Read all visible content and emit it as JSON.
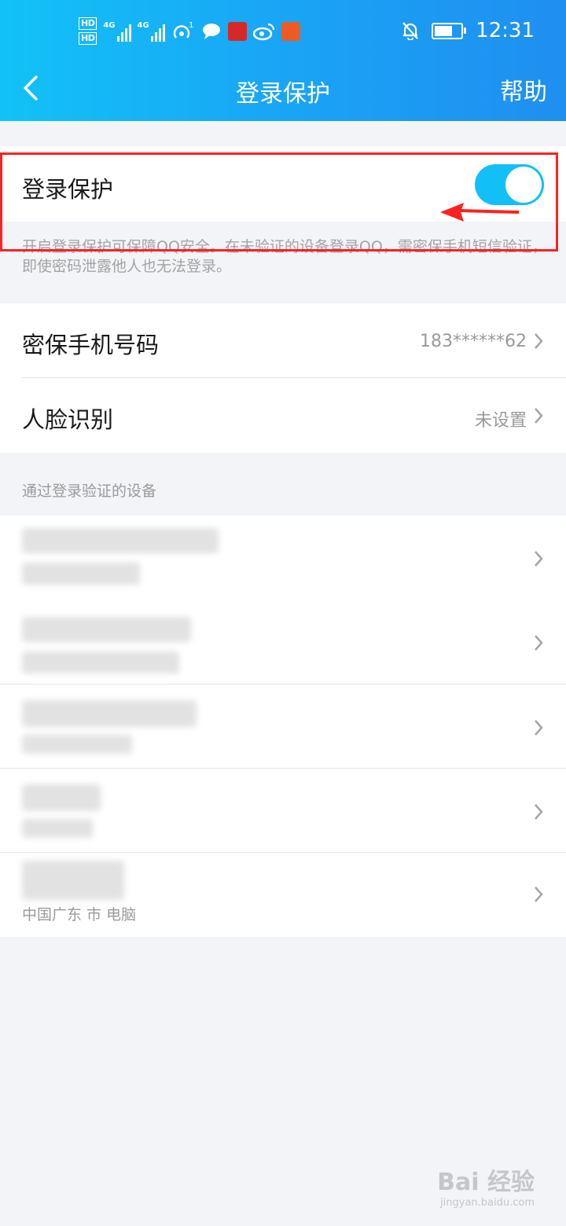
{
  "status_bar": {
    "left_icons": [
      "hd-badge",
      "signal-4g-1",
      "signal-4g-2",
      "hotspot-icon",
      "chat-bubble-icon",
      "red-app-icon",
      "weibo-icon",
      "orange-app-icon"
    ],
    "hd_label": "HD",
    "network_label": "4G",
    "hotspot_count": "1",
    "time": "12:31",
    "right_icons": [
      "bell-off-icon",
      "battery-icon"
    ]
  },
  "nav": {
    "title": "登录保护",
    "help_label": "帮助"
  },
  "login_protection": {
    "label": "登录保护",
    "enabled": true,
    "description": "开启登录保护可保障QQ安全。在未验证的设备登录QQ，需密保手机短信验证，即使密码泄露他人也无法登录。"
  },
  "security": {
    "rows": [
      {
        "label": "密保手机号码",
        "value": "183******62"
      },
      {
        "label": "人脸识别",
        "value": "未设置"
      }
    ]
  },
  "devices": {
    "section_title": "通过登录验证的设备",
    "last_item_text": "中国广东 市 电脑"
  },
  "watermark": {
    "brand": "Bai 经验",
    "sub": "jingyan.baidu.com"
  },
  "colors": {
    "header_start": "#12c2f7",
    "header_end": "#1f8ff0",
    "toggle_on": "#12c0f7",
    "annotation_red": "#ff2222",
    "background": "#f2f4f8"
  }
}
